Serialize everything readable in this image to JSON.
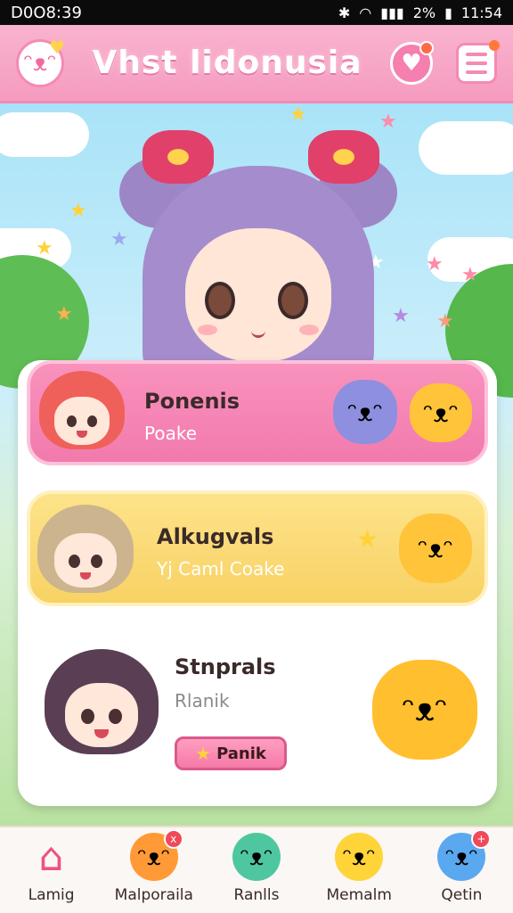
{
  "status_bar": {
    "time_left": "D0O8:39",
    "battery": "2%",
    "time_right": "11:54"
  },
  "header": {
    "title": "Vhst lidonusia",
    "mascot_icon": "mascot-cloud-icon",
    "heart_icon": "heart-badge-icon",
    "menu_icon": "menu-icon"
  },
  "cards": [
    {
      "title": "Ponenis",
      "subtitle": "Poake",
      "color": "#f27aad"
    },
    {
      "title": "Alkugvals",
      "subtitle": "Yj Caml Coake",
      "color": "#f8d264"
    },
    {
      "title": "Stnprals",
      "subtitle": "Rlanik",
      "button_label": "Panik",
      "color": "#ffffff"
    }
  ],
  "bottom_nav": [
    {
      "label": "Lamig",
      "icon": "home-icon"
    },
    {
      "label": "Malporaila",
      "icon": "orange-pet-icon",
      "badge": "x"
    },
    {
      "label": "Ranlls",
      "icon": "green-pet-icon"
    },
    {
      "label": "Memalm",
      "icon": "yellow-pet-icon"
    },
    {
      "label": "Qetin",
      "icon": "blue-pet-icon",
      "badge": "+"
    }
  ],
  "colors": {
    "header_pink": "#f59bbf",
    "accent_pink": "#f27aad",
    "accent_yellow": "#f8d264"
  }
}
